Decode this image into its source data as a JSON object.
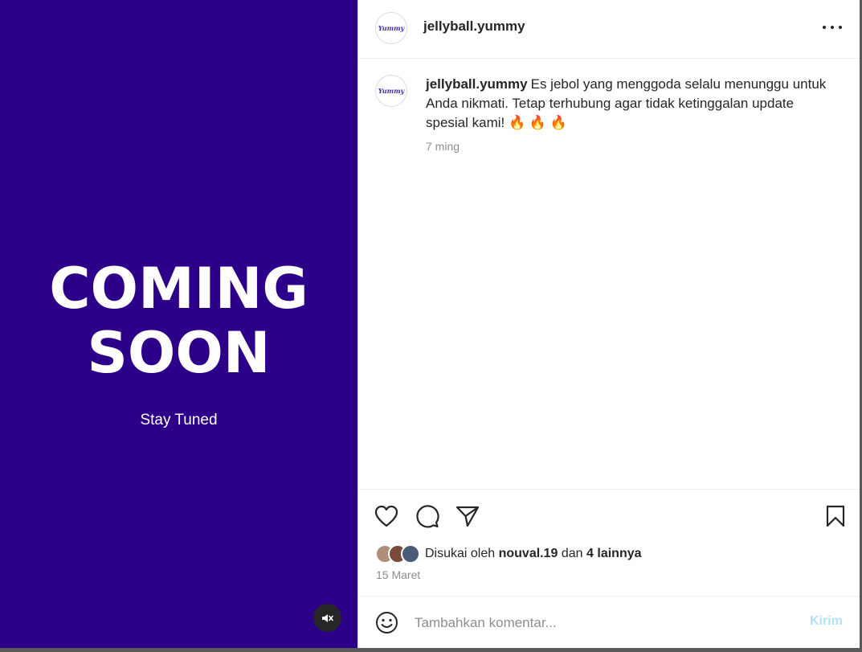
{
  "media": {
    "headline_line1": "COMING",
    "headline_line2": "SOON",
    "subtitle": "Stay Tuned",
    "background": "#2d0089",
    "mute_icon": "speaker-muted-icon"
  },
  "header": {
    "username": "jellyball.yummy",
    "logo_text": "Yummy",
    "more_icon": "more-horizontal-icon"
  },
  "caption": {
    "username": "jellyball.yummy",
    "text": "Es jebol yang menggoda selalu menunggu untuk Anda nikmati. Tetap terhubung agar tidak ketinggalan update spesial kami! 🔥 🔥 🔥",
    "time": "7 ming"
  },
  "actions": {
    "like_icon": "heart-icon",
    "comment_icon": "comment-icon",
    "share_icon": "send-icon",
    "save_icon": "bookmark-icon"
  },
  "likes": {
    "prefix": "Disukai oleh",
    "user": "nouval.19",
    "middle": "dan",
    "others": "4 lainnya"
  },
  "date": "15 Maret",
  "comment": {
    "placeholder": "Tambahkan komentar...",
    "send_label": "Kirim",
    "emoji_icon": "emoji-smile-icon"
  },
  "colors": {
    "accent_send_disabled": "#b2dffc",
    "text": "#262626",
    "secondary_text": "#8e8e8e"
  }
}
